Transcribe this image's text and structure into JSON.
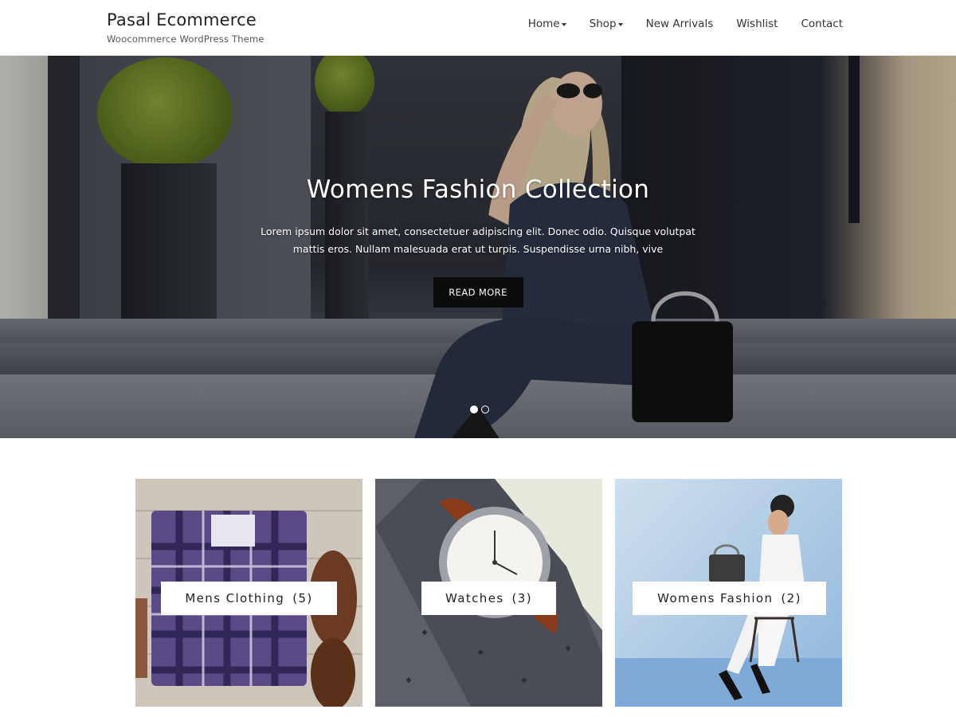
{
  "site": {
    "title": "Pasal Ecommerce",
    "tagline": "Woocommerce WordPress Theme"
  },
  "nav": {
    "items": [
      {
        "label": "Home",
        "dropdown": true
      },
      {
        "label": "Shop",
        "dropdown": true
      },
      {
        "label": "New Arrivals",
        "dropdown": false
      },
      {
        "label": "Wishlist",
        "dropdown": false
      },
      {
        "label": "Contact",
        "dropdown": false
      }
    ]
  },
  "hero": {
    "title": "Womens Fashion Collection",
    "description": "Lorem ipsum dolor sit amet, consectetuer adipiscing elit. Donec odio. Quisque volutpat mattis eros. Nullam malesuada erat ut turpis. Suspendisse urna nibh, vive",
    "button_label": "READ MORE",
    "slides_total": 2,
    "active_slide": 1
  },
  "categories": [
    {
      "name": "Mens Clothing",
      "count": "(5)",
      "image": "plaid-shirt-and-shoes"
    },
    {
      "name": "Watches",
      "count": "(3)",
      "image": "wristwatch-on-fabric"
    },
    {
      "name": "Womens Fashion",
      "count": "(2)",
      "image": "woman-seated-in-white"
    }
  ],
  "colors": {
    "header_bg": "#ffffff",
    "button_bg": "#0b0b0b",
    "button_text": "#ffffff",
    "text_dark": "#222222"
  }
}
